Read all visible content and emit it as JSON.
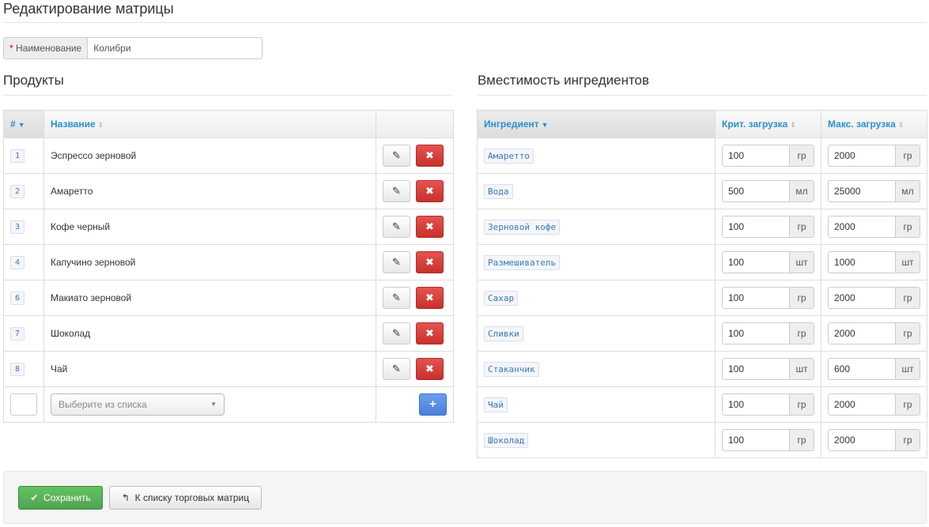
{
  "page": {
    "title": "Редактирование матрицы"
  },
  "name_field": {
    "required_mark": "*",
    "label": "Наименование",
    "value": "Колибри"
  },
  "products": {
    "title": "Продукты",
    "col_num": "#",
    "col_name": "Название",
    "rows": [
      {
        "num": "1",
        "name": "Эспрессо зерновой"
      },
      {
        "num": "2",
        "name": "Амаретто"
      },
      {
        "num": "3",
        "name": "Кофе черный"
      },
      {
        "num": "4",
        "name": "Капучино зерновой"
      },
      {
        "num": "6",
        "name": "Макиато зерновой"
      },
      {
        "num": "7",
        "name": "Шоколад"
      },
      {
        "num": "8",
        "name": "Чай"
      }
    ],
    "edit_icon": "pencil-icon",
    "delete_icon": "remove-icon",
    "edit_glyph": "✎",
    "delete_glyph": "✖",
    "add_glyph": "+",
    "select_placeholder": "Выберите из списка",
    "select_caret": "▼"
  },
  "ingredients": {
    "title": "Вместимость ингредиентов",
    "col_ingredient": "Ингредиент",
    "col_crit": "Крит. загрузка",
    "col_max": "Макс. загрузка",
    "rows": [
      {
        "name": "Амаретто",
        "crit": "100",
        "crit_unit": "гр",
        "max": "2000",
        "max_unit": "гр"
      },
      {
        "name": "Вода",
        "crit": "500",
        "crit_unit": "мл",
        "max": "25000",
        "max_unit": "мл"
      },
      {
        "name": "Зерновой кофе",
        "crit": "100",
        "crit_unit": "гр",
        "max": "2000",
        "max_unit": "гр"
      },
      {
        "name": "Размешиватель",
        "crit": "100",
        "crit_unit": "шт",
        "max": "1000",
        "max_unit": "шт"
      },
      {
        "name": "Сахар",
        "crit": "100",
        "crit_unit": "гр",
        "max": "2000",
        "max_unit": "гр"
      },
      {
        "name": "Сливки",
        "crit": "100",
        "crit_unit": "гр",
        "max": "2000",
        "max_unit": "гр"
      },
      {
        "name": "Стаканчик",
        "crit": "100",
        "crit_unit": "шт",
        "max": "600",
        "max_unit": "шт"
      },
      {
        "name": "Чай",
        "crit": "100",
        "crit_unit": "гр",
        "max": "2000",
        "max_unit": "гр"
      },
      {
        "name": "Шоколад",
        "crit": "100",
        "crit_unit": "гр",
        "max": "2000",
        "max_unit": "гр"
      }
    ]
  },
  "icons": {
    "sort_active": "▼",
    "sort_inactive": "⇕",
    "save_glyph": "✔",
    "back_glyph": "↰"
  },
  "footer": {
    "save_label": "Сохранить",
    "back_label": "К списку торговых матриц"
  },
  "colors": {
    "accent": "#2a8fd0",
    "danger": "#c8302c",
    "success": "#51a351",
    "primary": "#4a7fd8"
  }
}
